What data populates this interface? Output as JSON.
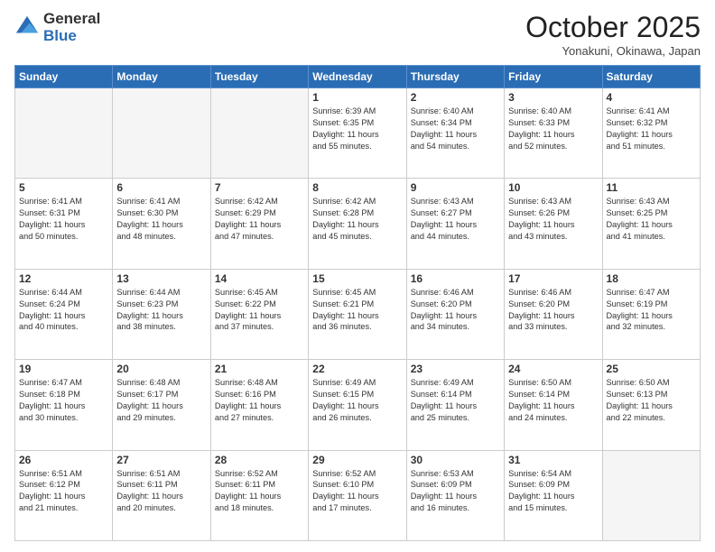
{
  "logo": {
    "general": "General",
    "blue": "Blue"
  },
  "header": {
    "month": "October 2025",
    "location": "Yonakuni, Okinawa, Japan"
  },
  "weekdays": [
    "Sunday",
    "Monday",
    "Tuesday",
    "Wednesday",
    "Thursday",
    "Friday",
    "Saturday"
  ],
  "rows": [
    [
      {
        "day": "",
        "content": ""
      },
      {
        "day": "",
        "content": ""
      },
      {
        "day": "",
        "content": ""
      },
      {
        "day": "1",
        "content": "Sunrise: 6:39 AM\nSunset: 6:35 PM\nDaylight: 11 hours\nand 55 minutes."
      },
      {
        "day": "2",
        "content": "Sunrise: 6:40 AM\nSunset: 6:34 PM\nDaylight: 11 hours\nand 54 minutes."
      },
      {
        "day": "3",
        "content": "Sunrise: 6:40 AM\nSunset: 6:33 PM\nDaylight: 11 hours\nand 52 minutes."
      },
      {
        "day": "4",
        "content": "Sunrise: 6:41 AM\nSunset: 6:32 PM\nDaylight: 11 hours\nand 51 minutes."
      }
    ],
    [
      {
        "day": "5",
        "content": "Sunrise: 6:41 AM\nSunset: 6:31 PM\nDaylight: 11 hours\nand 50 minutes."
      },
      {
        "day": "6",
        "content": "Sunrise: 6:41 AM\nSunset: 6:30 PM\nDaylight: 11 hours\nand 48 minutes."
      },
      {
        "day": "7",
        "content": "Sunrise: 6:42 AM\nSunset: 6:29 PM\nDaylight: 11 hours\nand 47 minutes."
      },
      {
        "day": "8",
        "content": "Sunrise: 6:42 AM\nSunset: 6:28 PM\nDaylight: 11 hours\nand 45 minutes."
      },
      {
        "day": "9",
        "content": "Sunrise: 6:43 AM\nSunset: 6:27 PM\nDaylight: 11 hours\nand 44 minutes."
      },
      {
        "day": "10",
        "content": "Sunrise: 6:43 AM\nSunset: 6:26 PM\nDaylight: 11 hours\nand 43 minutes."
      },
      {
        "day": "11",
        "content": "Sunrise: 6:43 AM\nSunset: 6:25 PM\nDaylight: 11 hours\nand 41 minutes."
      }
    ],
    [
      {
        "day": "12",
        "content": "Sunrise: 6:44 AM\nSunset: 6:24 PM\nDaylight: 11 hours\nand 40 minutes."
      },
      {
        "day": "13",
        "content": "Sunrise: 6:44 AM\nSunset: 6:23 PM\nDaylight: 11 hours\nand 38 minutes."
      },
      {
        "day": "14",
        "content": "Sunrise: 6:45 AM\nSunset: 6:22 PM\nDaylight: 11 hours\nand 37 minutes."
      },
      {
        "day": "15",
        "content": "Sunrise: 6:45 AM\nSunset: 6:21 PM\nDaylight: 11 hours\nand 36 minutes."
      },
      {
        "day": "16",
        "content": "Sunrise: 6:46 AM\nSunset: 6:20 PM\nDaylight: 11 hours\nand 34 minutes."
      },
      {
        "day": "17",
        "content": "Sunrise: 6:46 AM\nSunset: 6:20 PM\nDaylight: 11 hours\nand 33 minutes."
      },
      {
        "day": "18",
        "content": "Sunrise: 6:47 AM\nSunset: 6:19 PM\nDaylight: 11 hours\nand 32 minutes."
      }
    ],
    [
      {
        "day": "19",
        "content": "Sunrise: 6:47 AM\nSunset: 6:18 PM\nDaylight: 11 hours\nand 30 minutes."
      },
      {
        "day": "20",
        "content": "Sunrise: 6:48 AM\nSunset: 6:17 PM\nDaylight: 11 hours\nand 29 minutes."
      },
      {
        "day": "21",
        "content": "Sunrise: 6:48 AM\nSunset: 6:16 PM\nDaylight: 11 hours\nand 27 minutes."
      },
      {
        "day": "22",
        "content": "Sunrise: 6:49 AM\nSunset: 6:15 PM\nDaylight: 11 hours\nand 26 minutes."
      },
      {
        "day": "23",
        "content": "Sunrise: 6:49 AM\nSunset: 6:14 PM\nDaylight: 11 hours\nand 25 minutes."
      },
      {
        "day": "24",
        "content": "Sunrise: 6:50 AM\nSunset: 6:14 PM\nDaylight: 11 hours\nand 24 minutes."
      },
      {
        "day": "25",
        "content": "Sunrise: 6:50 AM\nSunset: 6:13 PM\nDaylight: 11 hours\nand 22 minutes."
      }
    ],
    [
      {
        "day": "26",
        "content": "Sunrise: 6:51 AM\nSunset: 6:12 PM\nDaylight: 11 hours\nand 21 minutes."
      },
      {
        "day": "27",
        "content": "Sunrise: 6:51 AM\nSunset: 6:11 PM\nDaylight: 11 hours\nand 20 minutes."
      },
      {
        "day": "28",
        "content": "Sunrise: 6:52 AM\nSunset: 6:11 PM\nDaylight: 11 hours\nand 18 minutes."
      },
      {
        "day": "29",
        "content": "Sunrise: 6:52 AM\nSunset: 6:10 PM\nDaylight: 11 hours\nand 17 minutes."
      },
      {
        "day": "30",
        "content": "Sunrise: 6:53 AM\nSunset: 6:09 PM\nDaylight: 11 hours\nand 16 minutes."
      },
      {
        "day": "31",
        "content": "Sunrise: 6:54 AM\nSunset: 6:09 PM\nDaylight: 11 hours\nand 15 minutes."
      },
      {
        "day": "",
        "content": ""
      }
    ]
  ]
}
